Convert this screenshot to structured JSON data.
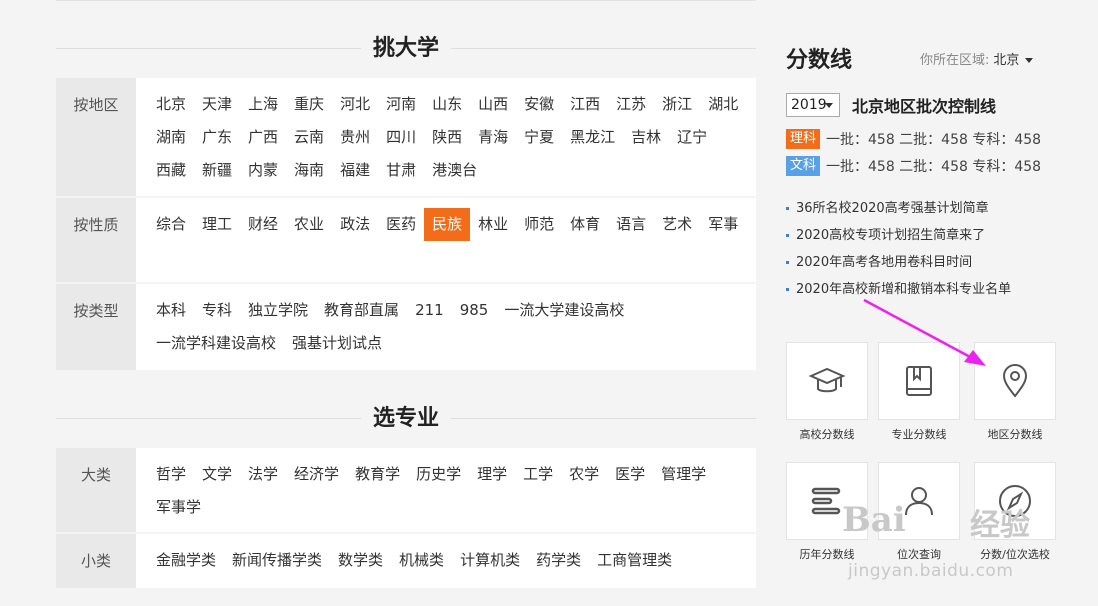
{
  "colleges": {
    "title": "挑大学",
    "rows": [
      {
        "label": "按地区",
        "items": [
          "北京",
          "天津",
          "上海",
          "重庆",
          "河北",
          "河南",
          "山东",
          "山西",
          "安徽",
          "江西",
          "江苏",
          "浙江",
          "湖北",
          "湖南",
          "广东",
          "广西",
          "云南",
          "贵州",
          "四川",
          "陕西",
          "青海",
          "宁夏",
          "黑龙江",
          "吉林",
          "辽宁",
          "西藏",
          "新疆",
          "内蒙",
          "海南",
          "福建",
          "甘肃",
          "港澳台"
        ]
      },
      {
        "label": "按性质",
        "items": [
          "综合",
          "理工",
          "财经",
          "农业",
          "政法",
          "医药",
          "民族",
          "林业",
          "师范",
          "体育",
          "语言",
          "艺术",
          "军事"
        ],
        "active": "民族"
      },
      {
        "label": "按类型",
        "items": [
          "本科",
          "专科",
          "独立学院",
          "教育部直属",
          "211",
          "985",
          "一流大学建设高校",
          "一流学科建设高校",
          "强基计划试点"
        ]
      }
    ]
  },
  "majors": {
    "title": "选专业",
    "rows": [
      {
        "label": "大类",
        "items": [
          "哲学",
          "文学",
          "法学",
          "经济学",
          "教育学",
          "历史学",
          "理学",
          "工学",
          "农学",
          "医学",
          "管理学",
          "军事学"
        ]
      },
      {
        "label": "小类",
        "items": [
          "金融学类",
          "新闻传播学类",
          "数学类",
          "机械类",
          "计算机类",
          "药学类",
          "工商管理类"
        ]
      }
    ]
  },
  "score": {
    "title": "分数线",
    "region_label": "你所在区域:",
    "region_value": "北京",
    "year": "2019",
    "caption": "北京地区批次控制线",
    "lines": [
      {
        "tag": "理科",
        "text": "一批：458 二批：458 专科：458"
      },
      {
        "tag": "文科",
        "text": "一批：458 二批：458 专科：458"
      }
    ],
    "news": [
      "36所名校2020高考强基计划简章",
      "2020高校专项计划招生简章来了",
      "2020年高考各地用卷科目时间",
      "2020年高校新增和撤销本科专业名单"
    ],
    "tools": [
      {
        "label": "高校分数线",
        "icon": "graduation-cap-icon"
      },
      {
        "label": "专业分数线",
        "icon": "book-icon"
      },
      {
        "label": "地区分数线",
        "icon": "location-pin-icon"
      },
      {
        "label": "历年分数线",
        "icon": "list-lines-icon"
      },
      {
        "label": "位次查询",
        "icon": "user-icon"
      },
      {
        "label": "分数/位次选校",
        "icon": "compass-icon"
      }
    ]
  },
  "watermark": {
    "brand": "Bai",
    "brand2": "经验",
    "url": "jingyan.baidu.com"
  },
  "colors": {
    "accent": "#f26c1a",
    "arts": "#5aa0e6",
    "arrow": "#ee22ee"
  }
}
